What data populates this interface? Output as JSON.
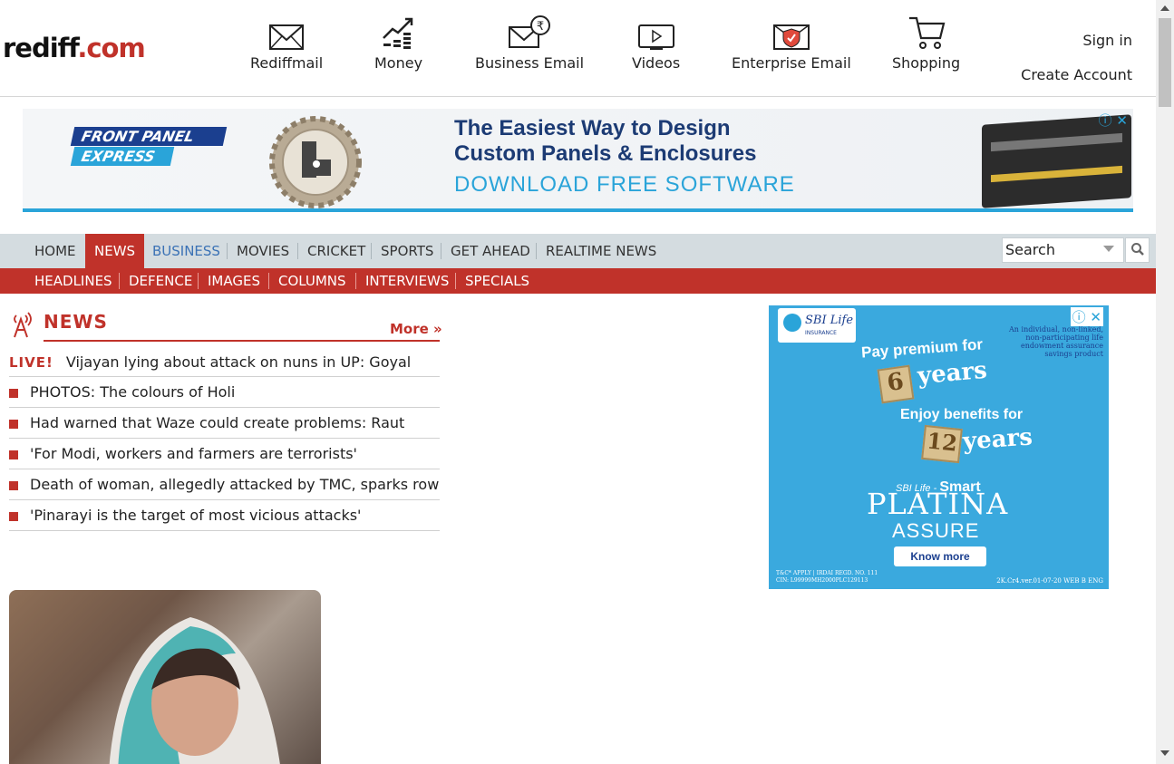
{
  "logo": {
    "part1": "rediff",
    "part2": ".com"
  },
  "services": [
    {
      "label": "Rediffmail",
      "icon": "mail-icon"
    },
    {
      "label": "Money",
      "icon": "money-chart-icon"
    },
    {
      "label": "Business Email",
      "icon": "business-email-icon"
    },
    {
      "label": "Videos",
      "icon": "video-play-icon"
    },
    {
      "label": "Enterprise Email",
      "icon": "enterprise-email-shield-icon"
    },
    {
      "label": "Shopping",
      "icon": "shopping-cart-icon"
    }
  ],
  "account": {
    "sign_in": "Sign in",
    "create_account": "Create Account"
  },
  "top_ad": {
    "brand_line1": "FRONT PANEL",
    "brand_line2": "EXPRESS",
    "headline_line1": "The Easiest Way to Design",
    "headline_line2": "Custom Panels & Enclosures",
    "cta": "DOWNLOAD FREE SOFTWARE",
    "info_glyph": "ⓘ",
    "close_glyph": "✕"
  },
  "nav": {
    "items": [
      "HOME",
      "NEWS",
      "BUSINESS",
      "MOVIES",
      "CRICKET",
      "SPORTS",
      "GET AHEAD",
      "REALTIME NEWS"
    ],
    "active": "NEWS",
    "search_value": "Search"
  },
  "subnav": {
    "items": [
      "HEADLINES",
      "DEFENCE",
      "IMAGES",
      "COLUMNS",
      "INTERVIEWS",
      "SPECIALS"
    ]
  },
  "news": {
    "title": "NEWS",
    "more": "More »",
    "live_tag": "LIVE!",
    "live_headline": "Vijayan lying about attack on nuns in UP: Goyal",
    "headlines": [
      "PHOTOS: The colours of Holi",
      "Had warned that Waze could create problems: Raut",
      "'For Modi, workers and farmers are terrorists'",
      "Death of woman, allegedly attacked by TMC, sparks row",
      "'Pinarayi is the target of most vicious attacks'"
    ]
  },
  "side_ad": {
    "brand": "SBI Life",
    "brand_sub": "INSURANCE",
    "disclaimer": "An individual, non-linked, non-participating life endowment assurance savings product",
    "pay_line": "Pay premium for",
    "years_pay": "6",
    "years_word": "years",
    "enjoy_line": "Enjoy benefits for",
    "years_benefit": "12",
    "smart_prefix": "SBI Life -",
    "smart_word": "Smart",
    "product_line1": "PLATINA",
    "product_line2": "ASSURE",
    "cta": "Know more",
    "tc": "T&C* APPLY | IRDAI REGD. NO. 111",
    "cin": "CIN: L99999MH2000PLC129113",
    "code": "2K.Cr4.ver.01-07-20 WEB B ENG"
  },
  "colors": {
    "brand_red": "#c0322a",
    "nav_bg": "#d4dce0",
    "link_blue": "#3b72b5",
    "ad_blue": "#2aa4d9"
  }
}
